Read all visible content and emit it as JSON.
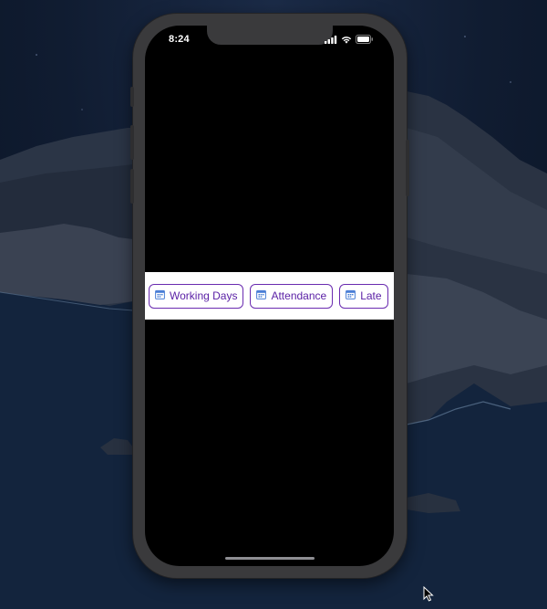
{
  "status_bar": {
    "time": "8:24",
    "icons": [
      "signal-icon",
      "wifi-icon",
      "battery-icon"
    ]
  },
  "chips": [
    {
      "label": "Working Days",
      "icon": "calendar-icon"
    },
    {
      "label": "Attendance",
      "icon": "calendar-icon"
    },
    {
      "label": "Late",
      "icon": "calendar-icon"
    }
  ],
  "colors": {
    "chip_border": "#6a2bb0",
    "chip_text": "#5b21a6",
    "chip_icon": "#4a7fd6",
    "strip_background": "#ffffff",
    "screen_background": "#000000",
    "phone_frame": "#3a3a3c"
  }
}
